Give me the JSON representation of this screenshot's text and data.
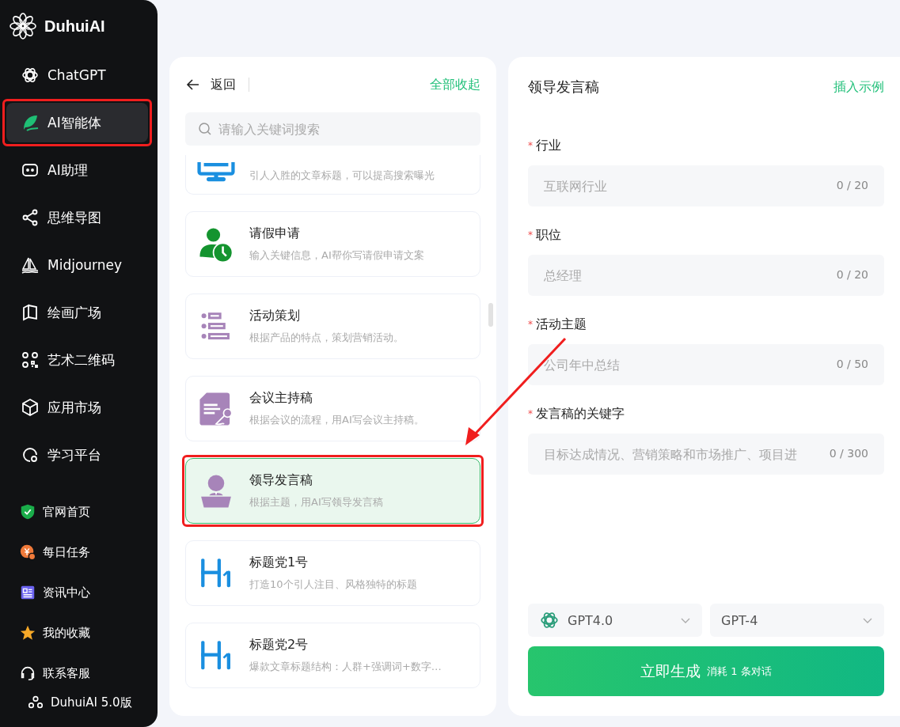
{
  "sidebar": {
    "brand": "DuhuiAI",
    "items": [
      {
        "kind": "openai",
        "label": "ChatGPT",
        "selected": false,
        "annotated": false
      },
      {
        "kind": "leaf",
        "label": "AI智能体",
        "selected": true,
        "annotated": true
      },
      {
        "kind": "bot",
        "label": "AI助理",
        "selected": false,
        "annotated": false
      },
      {
        "kind": "mindmap",
        "label": "思维导图",
        "selected": false,
        "annotated": false
      },
      {
        "kind": "boat",
        "label": "Midjourney",
        "selected": false,
        "annotated": false
      },
      {
        "kind": "book",
        "label": "绘画广场",
        "selected": false,
        "annotated": false
      },
      {
        "kind": "qr",
        "label": "艺术二维码",
        "selected": false,
        "annotated": false
      },
      {
        "kind": "cube",
        "label": "应用市场",
        "selected": false,
        "annotated": false
      },
      {
        "kind": "learn",
        "label": "学习平台",
        "selected": false,
        "annotated": false
      }
    ],
    "links": [
      {
        "kind": "shield",
        "label": "官网首页"
      },
      {
        "kind": "coin",
        "label": "每日任务"
      },
      {
        "kind": "news",
        "label": "资讯中心"
      },
      {
        "kind": "star",
        "label": "我的收藏"
      },
      {
        "kind": "headset",
        "label": "联系客服"
      }
    ],
    "version": "DuhuiAI 5.0版"
  },
  "list_panel": {
    "back": "返回",
    "collapse_all": "全部收起",
    "search": {
      "placeholder": "请输入关键词搜索"
    },
    "cards": [
      {
        "kind": "monitor",
        "description": "引人入胜的文章标题，可以提高搜索曝光",
        "selected": false,
        "annotated": false
      },
      {
        "kind": "leave",
        "title": "请假申请",
        "description": "输入关键信息，AI帮你写请假申请文案",
        "selected": false,
        "annotated": false
      },
      {
        "kind": "list",
        "title": "活动策划",
        "description": "根据产品的特点，策划营销活动。",
        "selected": false,
        "annotated": false
      },
      {
        "kind": "document",
        "title": "会议主持稿",
        "description": "根据会议的流程，用AI写会议主持稿。",
        "selected": false,
        "annotated": false
      },
      {
        "kind": "speaker",
        "title": "领导发言稿",
        "description": "根据主题，用AI写领导发言稿",
        "selected": true,
        "annotated": true
      },
      {
        "kind": "heading",
        "title": "标题党1号",
        "description": "打造10个引人注目、风格独特的标题",
        "selected": false,
        "annotated": false
      },
      {
        "kind": "heading",
        "title": "标题党2号",
        "description": "爆款文章标题结构：人群+强调词+数字…",
        "selected": false,
        "annotated": false
      }
    ]
  },
  "form_panel": {
    "title": "领导发言稿",
    "insert_example": "插入示例",
    "fields": [
      {
        "label": "行业",
        "required_mark": "*",
        "placeholder": "互联网行业",
        "counter": "0 / 20"
      },
      {
        "label": "职位",
        "required_mark": "*",
        "placeholder": "总经理",
        "counter": "0 / 20"
      },
      {
        "label": "活动主题",
        "required_mark": "*",
        "placeholder": "公司年中总结",
        "counter": "0 / 50"
      },
      {
        "label": "发言稿的关键字",
        "required_mark": "*",
        "placeholder": "目标达成情况、营销策略和市场推广、项目进",
        "counter": "0 / 300"
      }
    ],
    "model_select": "GPT4.0",
    "version_select": "GPT-4",
    "generate_button": {
      "label": "立即生成",
      "cost": "消耗 1 条对话"
    }
  },
  "annotation_arrow": true
}
